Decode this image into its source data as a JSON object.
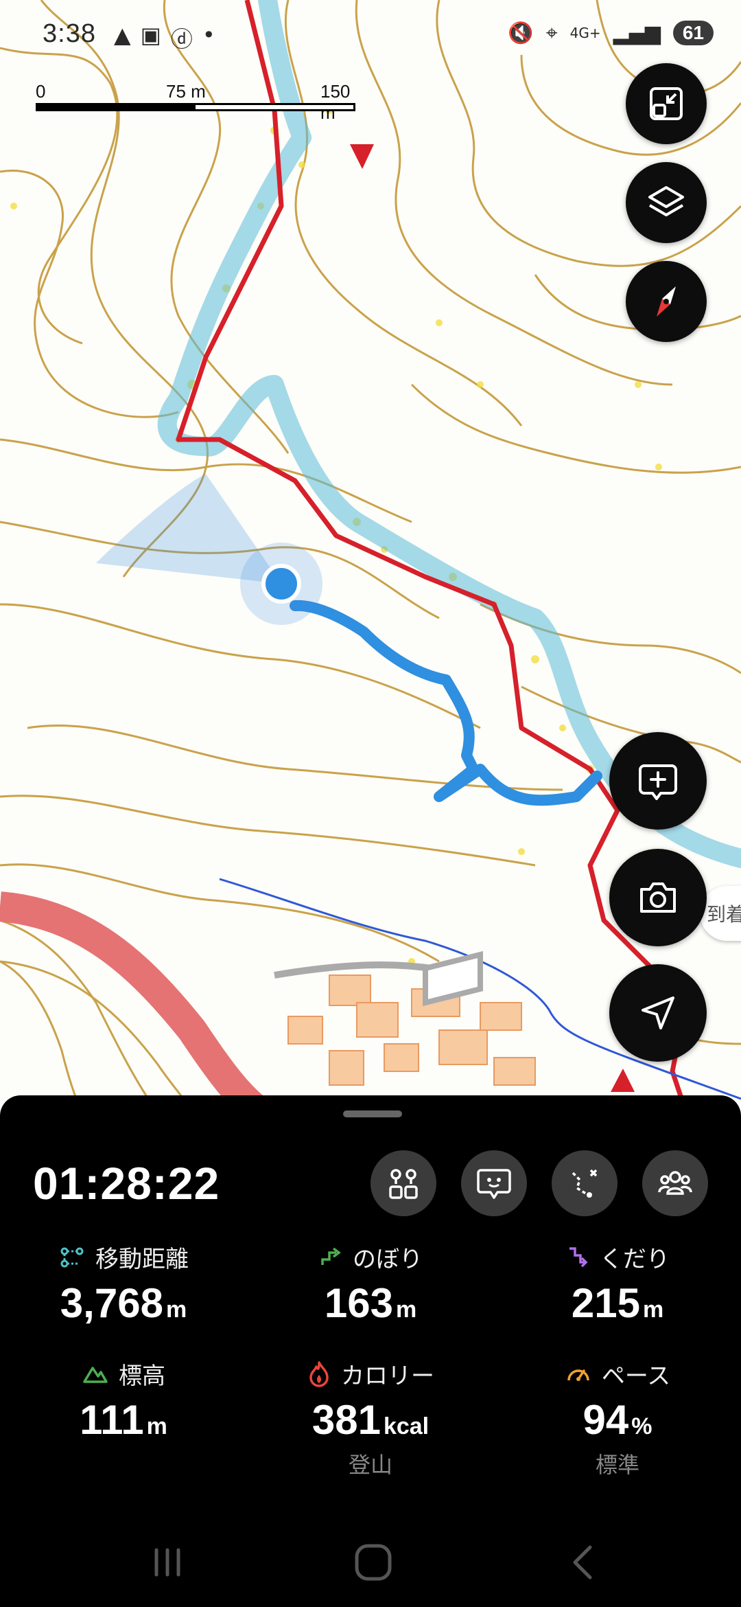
{
  "status_bar": {
    "time": "3:38",
    "battery": "61",
    "left_icons": [
      "navigation-triangle-icon",
      "screenshot-icon",
      "docomo-icon",
      "dot-icon"
    ],
    "right_icons": [
      "mute-icon",
      "location-icon",
      "4g-signal-icon",
      "signal-bars-icon",
      "battery-icon"
    ]
  },
  "scale_bar": {
    "zero": "0",
    "mid": "75 m",
    "max": "150 m"
  },
  "map": {
    "route_color": "#d6202a",
    "track_color": "#2f8fe0",
    "heat_color": "#5bbcd8",
    "contour_color": "#c9a24a",
    "road_color": "#e57373",
    "building_color": "#f8caa0",
    "arrival_label": "到着"
  },
  "map_controls": [
    "fit-screen-icon",
    "layers-icon",
    "compass-icon"
  ],
  "map_actions": [
    "add-memo-icon",
    "camera-icon",
    "navigate-icon"
  ],
  "panel": {
    "elapsed_time": "01:28:22",
    "action_icons": [
      "checkpoints-icon",
      "chat-icon",
      "route-icon",
      "group-icon"
    ],
    "stats": [
      {
        "id": "distance",
        "icon": "distance-icon",
        "icon_color": "#4fc3c8",
        "label": "移動距離",
        "value": "3,768",
        "unit": "m",
        "sub": ""
      },
      {
        "id": "ascent",
        "icon": "ascent-icon",
        "icon_color": "#4caf50",
        "label": "のぼり",
        "value": "163",
        "unit": "m",
        "sub": ""
      },
      {
        "id": "descent",
        "icon": "descent-icon",
        "icon_color": "#b070e8",
        "label": "くだり",
        "value": "215",
        "unit": "m",
        "sub": ""
      },
      {
        "id": "altitude",
        "icon": "mountain-icon",
        "icon_color": "#4caf50",
        "label": "標高",
        "value": "111",
        "unit": "m",
        "sub": ""
      },
      {
        "id": "calories",
        "icon": "flame-icon",
        "icon_color": "#e8453c",
        "label": "カロリー",
        "value": "381",
        "unit": "kcal",
        "sub": "登山"
      },
      {
        "id": "pace",
        "icon": "speedometer-icon",
        "icon_color": "#f0a030",
        "label": "ペース",
        "value": "94",
        "unit": "%",
        "sub": "標準"
      }
    ]
  },
  "nav_bar": [
    "recent-apps-icon",
    "home-icon",
    "back-icon"
  ]
}
